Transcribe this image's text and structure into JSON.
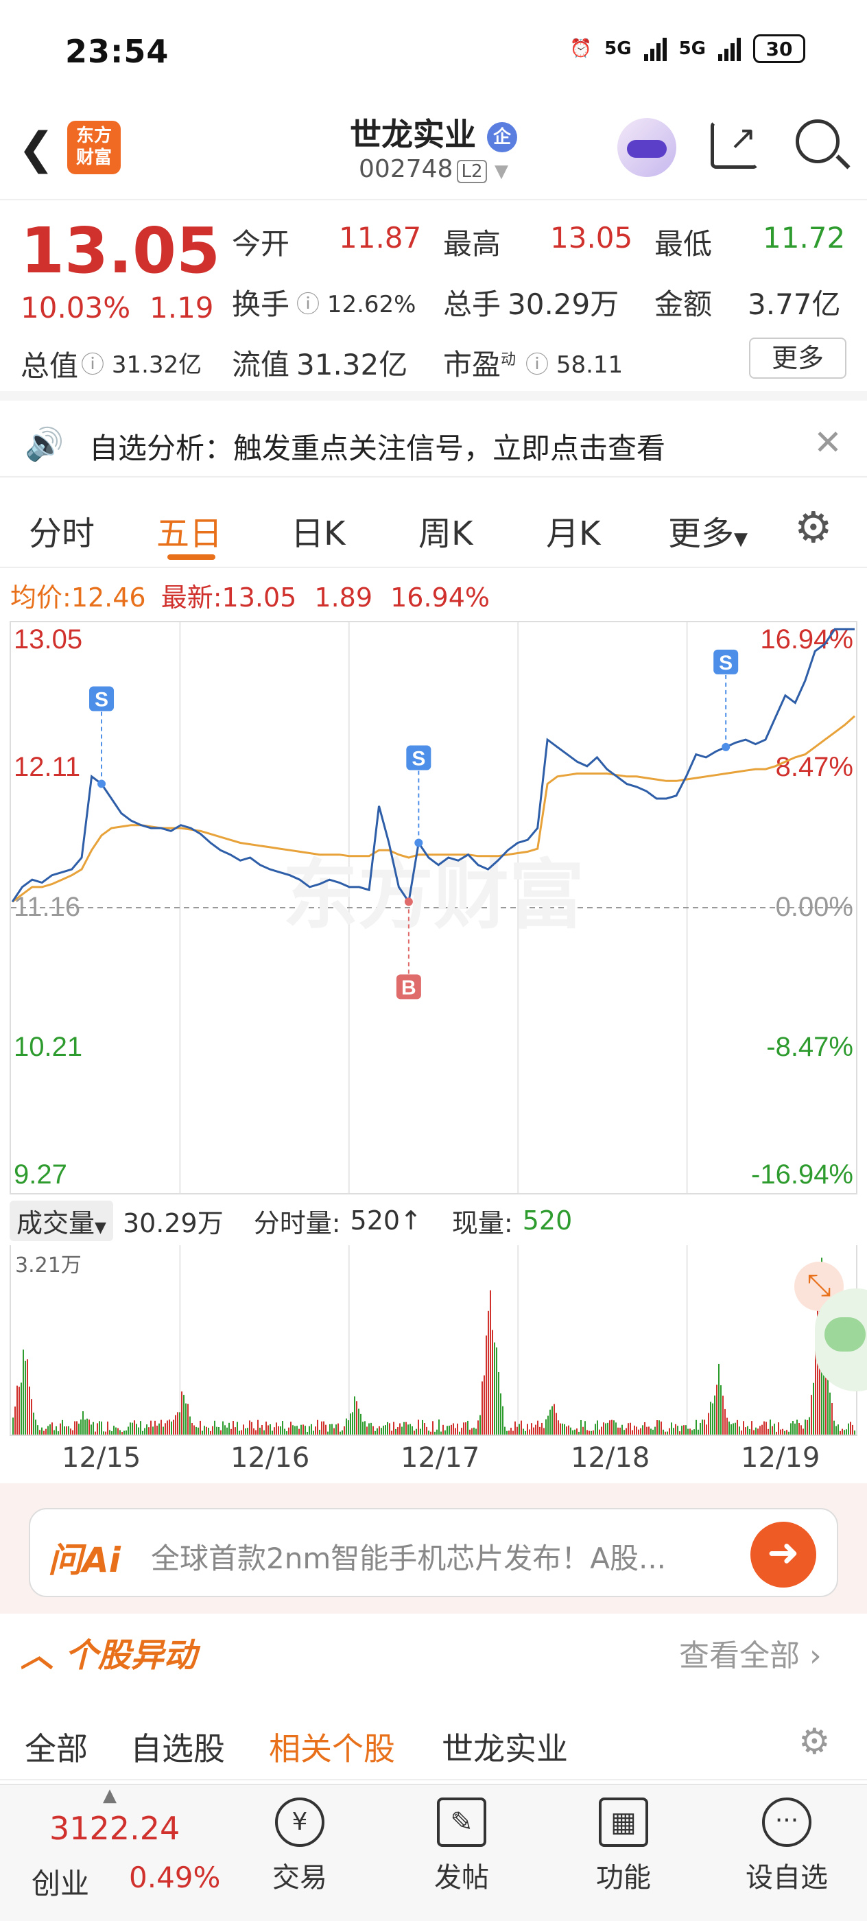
{
  "status": {
    "time": "23:54",
    "battery": "30",
    "net1": "5G",
    "net2": "5G"
  },
  "header": {
    "logo_line1": "东方",
    "logo_line2": "财富",
    "title": "世龙实业",
    "badge": "企",
    "code": "002748",
    "level": "L2"
  },
  "quote": {
    "price": "13.05",
    "change_pct": "10.03%",
    "change": "1.19",
    "open_label": "今开",
    "open": "11.87",
    "high_label": "最高",
    "high": "13.05",
    "low_label": "最低",
    "low": "11.72",
    "turnover_label": "换手",
    "turnover": "12.62%",
    "volume_label": "总手",
    "volume": "30.29万",
    "amount_label": "金额",
    "amount": "3.77亿",
    "mcap_label": "总值",
    "mcap": "31.32亿",
    "float_label": "流值",
    "float": "31.32亿",
    "pe_label": "市盈",
    "pe_sup": "动",
    "pe": "58.11",
    "more": "更多"
  },
  "notice": {
    "text": "自选分析：触发重点关注信号，立即点击查看"
  },
  "tabs": [
    "分时",
    "五日",
    "日K",
    "周K",
    "月K",
    "更多"
  ],
  "avg": {
    "avg_label": "均价:",
    "avg": "12.46",
    "latest_label": "最新:",
    "latest": "13.05",
    "chg": "1.89",
    "pct": "16.94%"
  },
  "chart_data": {
    "type": "line",
    "title": "",
    "xlabel": "",
    "ylabel": "",
    "categories": [
      "12/15",
      "12/16",
      "12/17",
      "12/18",
      "12/19"
    ],
    "ylim": [
      9.27,
      13.05
    ],
    "y_ticks_left": [
      "13.05",
      "12.11",
      "11.16",
      "10.21",
      "9.27"
    ],
    "y_ticks_right": [
      "16.94%",
      "8.47%",
      "0.00%",
      "-8.47%",
      "-16.94%"
    ],
    "prev_close": 11.16,
    "series": [],
    "price_points": [
      11.2,
      11.3,
      11.35,
      11.33,
      11.38,
      11.4,
      11.42,
      11.5,
      12.05,
      12.0,
      11.9,
      11.8,
      11.75,
      11.72,
      11.7,
      11.7,
      11.68,
      11.72,
      11.7,
      11.66,
      11.6,
      11.55,
      11.52,
      11.48,
      11.5,
      11.45,
      11.42,
      11.4,
      11.38,
      11.35,
      11.3,
      11.32,
      11.35,
      11.33,
      11.3,
      11.3,
      11.28,
      11.85,
      11.6,
      11.3,
      11.2,
      11.6,
      11.5,
      11.45,
      11.5,
      11.48,
      11.52,
      11.45,
      11.42,
      11.48,
      11.55,
      11.6,
      11.62,
      11.7,
      12.3,
      12.25,
      12.2,
      12.15,
      12.12,
      12.18,
      12.1,
      12.05,
      12.0,
      11.98,
      11.95,
      11.9,
      11.9,
      11.92,
      12.05,
      12.2,
      12.18,
      12.22,
      12.25,
      12.28,
      12.3,
      12.27,
      12.3,
      12.45,
      12.6,
      12.55,
      12.7,
      12.9,
      12.95,
      13.05,
      13.05,
      13.05
    ],
    "avg_points": [
      11.2,
      11.25,
      11.3,
      11.3,
      11.32,
      11.35,
      11.38,
      11.42,
      11.55,
      11.65,
      11.7,
      11.71,
      11.72,
      11.72,
      11.71,
      11.7,
      11.7,
      11.7,
      11.69,
      11.68,
      11.66,
      11.64,
      11.62,
      11.6,
      11.59,
      11.58,
      11.57,
      11.56,
      11.55,
      11.54,
      11.53,
      11.52,
      11.52,
      11.52,
      11.51,
      11.51,
      11.51,
      11.55,
      11.55,
      11.52,
      11.5,
      11.52,
      11.52,
      11.52,
      11.52,
      11.52,
      11.52,
      11.51,
      11.51,
      11.51,
      11.52,
      11.53,
      11.54,
      11.56,
      12.0,
      12.05,
      12.06,
      12.07,
      12.07,
      12.07,
      12.07,
      12.06,
      12.05,
      12.05,
      12.04,
      12.03,
      12.02,
      12.02,
      12.03,
      12.04,
      12.05,
      12.06,
      12.07,
      12.08,
      12.09,
      12.1,
      12.1,
      12.12,
      12.15,
      12.18,
      12.2,
      12.25,
      12.3,
      12.35,
      12.4,
      12.46
    ],
    "markers": [
      {
        "label": "S"
      },
      {
        "label": "S"
      },
      {
        "label": "S"
      },
      {
        "label": "B"
      }
    ],
    "volume_max_label": "3.21万"
  },
  "volume": {
    "label": "成交量",
    "total": "30.29万",
    "tick_label": "分时量:",
    "tick": "520↑",
    "now_label": "现量:",
    "now": "520"
  },
  "ask": {
    "brand": "问Ai",
    "text": "全球首款2nm智能手机芯片发布！A股..."
  },
  "section": {
    "title": "个股异动",
    "more": "查看全部"
  },
  "subtabs": [
    "全部",
    "自选股",
    "相关个股",
    "世龙实业"
  ],
  "bottom": {
    "index_value": "3122.24",
    "index_name": "创业",
    "index_pct": "0.49%",
    "items": [
      "交易",
      "发帖",
      "功能",
      "设自选"
    ]
  },
  "colors": {
    "up": "#d0312d",
    "down": "#2e9b2e",
    "accent": "#e8701a",
    "price_line": "#2e5ea8",
    "avg_line": "#e8a23a"
  }
}
